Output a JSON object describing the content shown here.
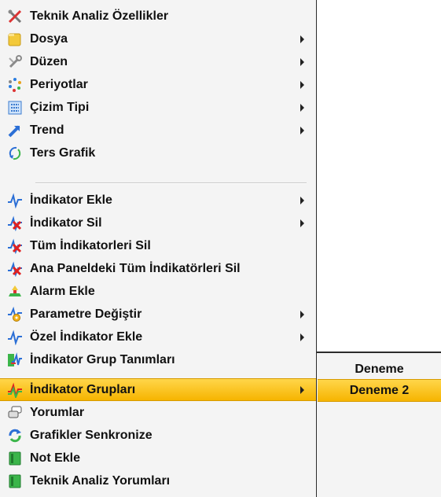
{
  "menu": {
    "items": [
      {
        "label": "Teknik Analiz Özellikler",
        "icon": "tools-icon",
        "submenu": false
      },
      {
        "label": "Dosya",
        "icon": "folder-icon",
        "submenu": true
      },
      {
        "label": "Düzen",
        "icon": "wrench-icon",
        "submenu": true
      },
      {
        "label": "Periyotlar",
        "icon": "periods-icon",
        "submenu": true
      },
      {
        "label": "Çizim Tipi",
        "icon": "chart-type-icon",
        "submenu": true
      },
      {
        "label": "Trend",
        "icon": "trend-arrow-icon",
        "submenu": true
      },
      {
        "label": "Ters Grafik",
        "icon": "invert-chart-icon",
        "submenu": false
      },
      {
        "label": "İndikator Ekle",
        "icon": "indicator-add-icon",
        "submenu": true
      },
      {
        "label": "İndikator Sil",
        "icon": "indicator-delete-icon",
        "submenu": true
      },
      {
        "label": "Tüm İndikatorleri Sil",
        "icon": "indicator-delete-all-icon",
        "submenu": false
      },
      {
        "label": "Ana Paneldeki Tüm İndikatörleri Sil",
        "icon": "indicator-delete-panel-icon",
        "submenu": false
      },
      {
        "label": "Alarm Ekle",
        "icon": "alarm-add-icon",
        "submenu": false
      },
      {
        "label": "Parametre Değiştir",
        "icon": "parameter-icon",
        "submenu": true
      },
      {
        "label": "Özel İndikator Ekle",
        "icon": "custom-indicator-icon",
        "submenu": true
      },
      {
        "label": "İndikator Grup Tanımları",
        "icon": "indicator-group-define-icon",
        "submenu": false
      },
      {
        "label": "İndikator Grupları",
        "icon": "indicator-groups-icon",
        "submenu": true,
        "highlighted": true
      },
      {
        "label": "Yorumlar",
        "icon": "comments-icon",
        "submenu": false
      },
      {
        "label": "Grafikler Senkronize",
        "icon": "sync-icon",
        "submenu": false
      },
      {
        "label": "Not Ekle",
        "icon": "note-add-icon",
        "submenu": false
      },
      {
        "label": "Teknik Analiz Yorumları",
        "icon": "analysis-comments-icon",
        "submenu": false
      }
    ]
  },
  "submenu": {
    "items": [
      {
        "label": "Deneme"
      },
      {
        "label": "Deneme 2",
        "highlighted": true
      }
    ]
  },
  "colors": {
    "highlight": "#f6b400",
    "menu_bg": "#f4f4f4",
    "border": "#2b2b2b"
  }
}
